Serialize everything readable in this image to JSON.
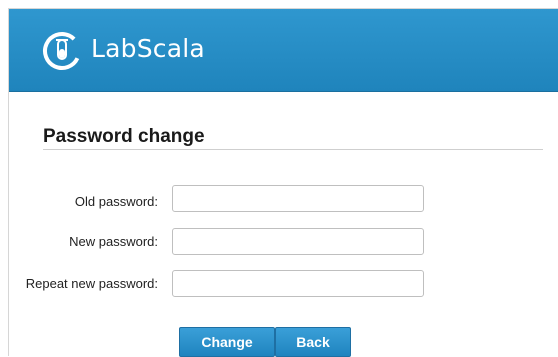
{
  "header": {
    "brand": "LabScala",
    "logo_icon": "test-tube-logo-icon"
  },
  "form": {
    "title": "Password change",
    "fields": [
      {
        "label": "Old password:",
        "value": ""
      },
      {
        "label": "New password:",
        "value": ""
      },
      {
        "label": "Repeat new password:",
        "value": ""
      }
    ],
    "buttons": {
      "change": "Change",
      "back": "Back"
    }
  },
  "colors": {
    "header_bg": "#2590c7",
    "button_bg": "#2a91cc",
    "text": "#222222"
  }
}
